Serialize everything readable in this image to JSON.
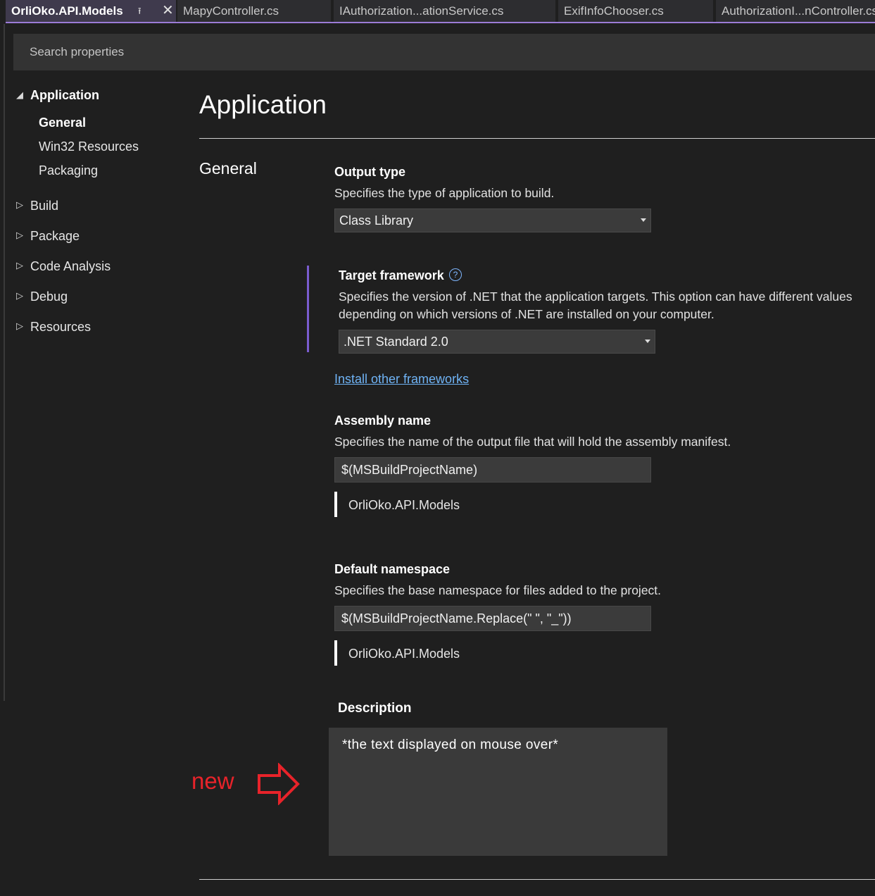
{
  "tabs": [
    {
      "label": "OrliOko.API.Models",
      "active": true
    },
    {
      "label": "MapyController.cs",
      "active": false
    },
    {
      "label": "IAuthorization...ationService.cs",
      "active": false
    },
    {
      "label": "ExifInfoChooser.cs",
      "active": false
    },
    {
      "label": "AuthorizationI...nController.cs",
      "active": false
    }
  ],
  "icons": {
    "pin": "pin-icon",
    "close": "close-icon",
    "help": "help-icon"
  },
  "search": {
    "placeholder": "Search properties"
  },
  "sidebar": {
    "application": "Application",
    "sub_items": [
      "General",
      "Win32 Resources",
      "Packaging"
    ],
    "items": [
      "Build",
      "Package",
      "Code Analysis",
      "Debug",
      "Resources"
    ]
  },
  "page": {
    "title": "Application",
    "section": "General"
  },
  "output_type": {
    "label": "Output type",
    "description": "Specifies the type of application to build.",
    "value": "Class Library"
  },
  "target_framework": {
    "label": "Target framework",
    "help_glyph": "?",
    "description": "Specifies the version of .NET that the application targets. This option can have different values depending on which versions of .NET are installed on your computer.",
    "value": ".NET Standard 2.0",
    "install_link": "Install other frameworks"
  },
  "assembly_name": {
    "label": "Assembly name",
    "description": "Specifies the name of the output file that will hold the assembly manifest.",
    "value": "$(MSBuildProjectName)",
    "evaluated": "OrliOko.API.Models"
  },
  "default_namespace": {
    "label": "Default namespace",
    "description": "Specifies the base namespace for files added to the project.",
    "value": "$(MSBuildProjectName.Replace(\" \", \"_\"))",
    "evaluated": "OrliOko.API.Models"
  },
  "description_field": {
    "label": "Description",
    "value": "*the text displayed on mouse over*"
  },
  "annotation": {
    "label": "new",
    "color": "#e8232a"
  },
  "colors": {
    "accent": "#9b7bd6",
    "link": "#6fb3f5",
    "background": "#1f1f1f"
  }
}
